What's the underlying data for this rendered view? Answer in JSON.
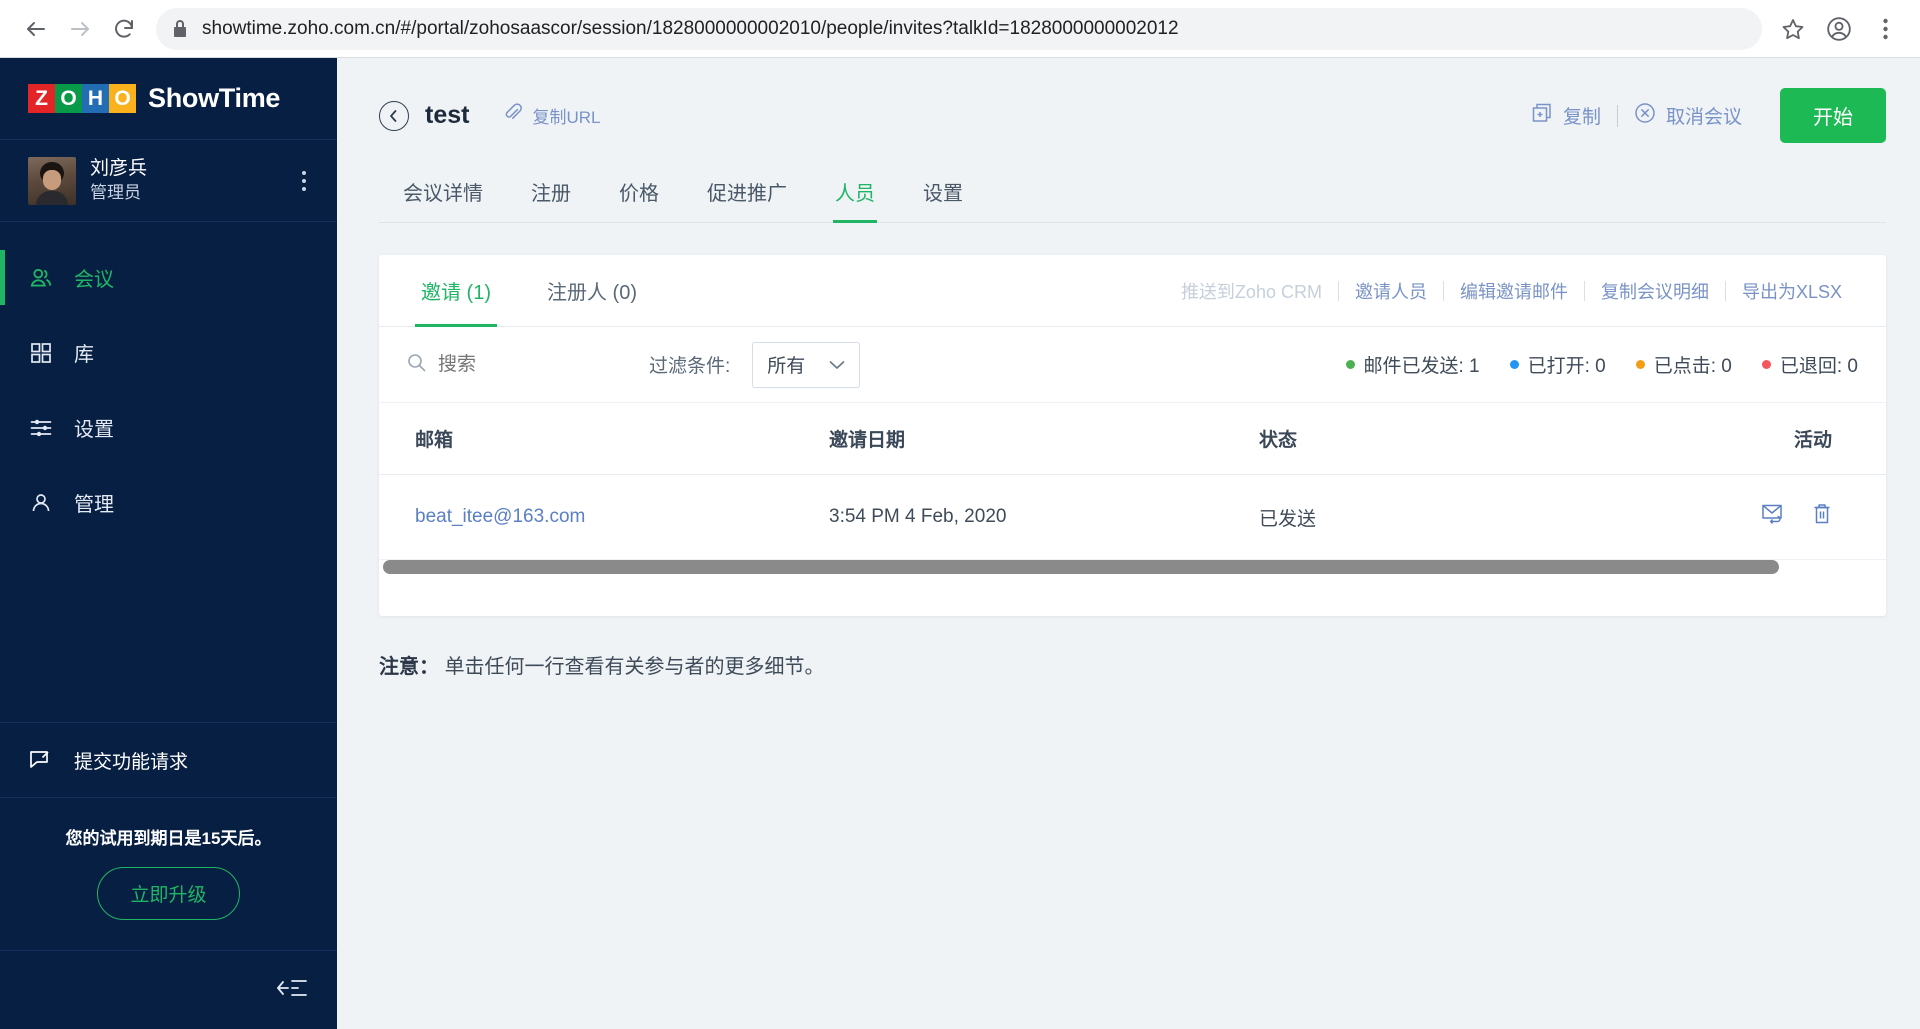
{
  "browser": {
    "url": "showtime.zoho.com.cn/#/portal/zohosaascor/session/1828000000002010/people/invites?talkId=1828000000002012",
    "back_icon": "back-arrow-icon",
    "forward_icon": "forward-arrow-icon",
    "reload_icon": "reload-icon",
    "lock_icon": "lock-icon",
    "star_icon": "bookmark-star-icon",
    "profile_icon": "profile-avatar-icon",
    "menu_icon": "browser-menu-icon"
  },
  "sidebar": {
    "brand": {
      "logo_letters": [
        "Z",
        "O",
        "H",
        "O"
      ],
      "product": "ShowTime"
    },
    "user": {
      "name": "刘彦兵",
      "role": "管理员"
    },
    "items": [
      {
        "label": "会议",
        "icon": "sessions-people-icon",
        "active": true
      },
      {
        "label": "库",
        "icon": "library-grid-icon",
        "active": false
      },
      {
        "label": "设置",
        "icon": "settings-sliders-icon",
        "active": false
      },
      {
        "label": "管理",
        "icon": "admin-user-icon",
        "active": false
      }
    ],
    "feature_request": {
      "label": "提交功能请求",
      "icon": "feedback-icon"
    },
    "trial": {
      "text": "您的试用到期日是15天后。",
      "upgrade_label": "立即升级"
    },
    "collapse_icon": "collapse-sidebar-icon"
  },
  "header": {
    "back_icon": "back-circle-icon",
    "title": "test",
    "copy_url": {
      "label": "复制URL",
      "icon": "link-clip-icon"
    },
    "actions": [
      {
        "label": "复制",
        "icon": "duplicate-icon"
      },
      {
        "label": "取消会议",
        "icon": "cancel-circle-icon"
      }
    ],
    "start_label": "开始",
    "start_color": "#1db954"
  },
  "tabs": [
    {
      "label": "会议详情",
      "active": false
    },
    {
      "label": "注册",
      "active": false
    },
    {
      "label": "价格",
      "active": false
    },
    {
      "label": "促进推广",
      "active": false
    },
    {
      "label": "人员",
      "active": true
    },
    {
      "label": "设置",
      "active": false
    }
  ],
  "card": {
    "tabs": [
      {
        "label": "邀请 (1)",
        "active": true
      },
      {
        "label": "注册人 (0)",
        "active": false
      }
    ],
    "links": [
      {
        "label": "推送到Zoho CRM",
        "disabled": true
      },
      {
        "label": "邀请人员",
        "disabled": false
      },
      {
        "label": "编辑邀请邮件",
        "disabled": false
      },
      {
        "label": "复制会议明细",
        "disabled": false
      },
      {
        "label": "导出为XLSX",
        "disabled": false
      }
    ],
    "search": {
      "placeholder": "搜索",
      "value": "",
      "icon": "search-icon"
    },
    "filter": {
      "label": "过滤条件:",
      "selected": "所有",
      "chevron": "chevron-down-icon"
    },
    "stats": [
      {
        "label": "邮件已发送: 1",
        "color": "#4caf50"
      },
      {
        "label": "已打开: 0",
        "color": "#2196f3"
      },
      {
        "label": "已点击: 0",
        "color": "#f59c16"
      },
      {
        "label": "已退回: 0",
        "color": "#f4565c"
      }
    ],
    "table": {
      "columns": [
        "邮箱",
        "邀请日期",
        "状态",
        "活动"
      ],
      "rows": [
        {
          "email": "beat_itee@163.com",
          "date": "3:54 PM 4 Feb, 2020",
          "status": "已发送",
          "actions": [
            "resend-email-icon",
            "delete-icon"
          ]
        }
      ]
    }
  },
  "note": {
    "prefix": "注意：",
    "text": "单击任何一行查看有关参与者的更多细节。"
  }
}
